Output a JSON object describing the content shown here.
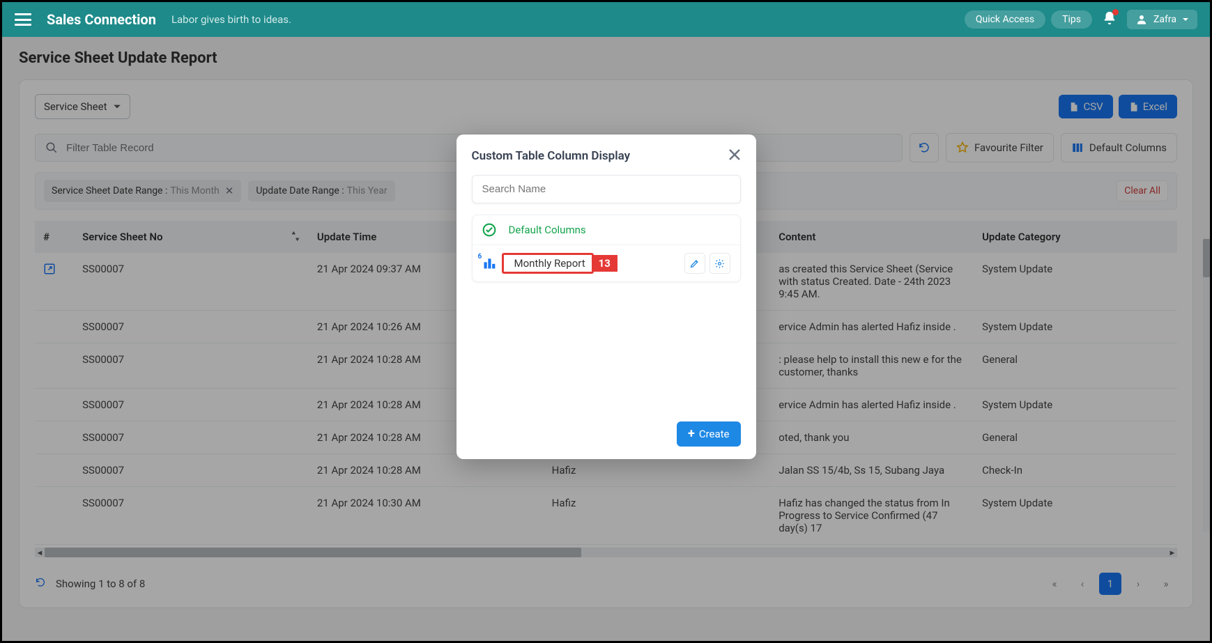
{
  "topbar": {
    "brand": "Sales Connection",
    "tagline": "Labor gives birth to ideas.",
    "quick_access": "Quick Access",
    "tips": "Tips",
    "user": "Zafra"
  },
  "page_title": "Service Sheet Update Report",
  "selector": {
    "label": "Service Sheet"
  },
  "export": {
    "csv": "CSV",
    "excel": "Excel"
  },
  "filter": {
    "placeholder": "Filter Table Record",
    "favourite": "Favourite Filter",
    "default_columns": "Default Columns",
    "clear_all": "Clear All",
    "chips": [
      {
        "label": "Service Sheet Date Range :",
        "value": "This Month"
      },
      {
        "label": "Update Date Range :",
        "value": "This Year"
      }
    ]
  },
  "columns": {
    "hash": "#",
    "ssn": "Service Sheet No",
    "time": "Update Time",
    "by": "",
    "content": "Content",
    "cat": "Update Category"
  },
  "rows": [
    {
      "ssn": "SS00007",
      "time": "21 Apr 2024 09:37 AM",
      "by": "",
      "content": "as created this Service Sheet (Service with status Created. Date - 24th 2023 9:45 AM.",
      "cat": "System Update",
      "open": true
    },
    {
      "ssn": "SS00007",
      "time": "21 Apr 2024 10:26 AM",
      "by": "",
      "content": "ervice Admin has alerted Hafiz inside .",
      "cat": "System Update"
    },
    {
      "ssn": "SS00007",
      "time": "21 Apr 2024 10:28 AM",
      "by": "",
      "content": ": please help to install this new e for the customer, thanks",
      "cat": "General"
    },
    {
      "ssn": "SS00007",
      "time": "21 Apr 2024 10:28 AM",
      "by": "",
      "content": "ervice Admin has alerted Hafiz inside .",
      "cat": "System Update"
    },
    {
      "ssn": "SS00007",
      "time": "21 Apr 2024 10:28 AM",
      "by": "",
      "content": "oted, thank you",
      "cat": "General"
    },
    {
      "ssn": "SS00007",
      "time": "21 Apr 2024 10:28 AM",
      "by": "Hafiz",
      "content": "Jalan SS 15/4b, Ss 15, Subang Jaya",
      "cat": "Check-In"
    },
    {
      "ssn": "SS00007",
      "time": "21 Apr 2024 10:30 AM",
      "by": "Hafiz",
      "content": "Hafiz has changed the status from In Progress to Service Confirmed (47 day(s) 17",
      "cat": "System Update"
    }
  ],
  "footer": {
    "info": "Showing 1 to 8 of 8",
    "page": "1"
  },
  "modal": {
    "title": "Custom Table Column Display",
    "search_placeholder": "Search Name",
    "default_label": "Default Columns",
    "monthly_label": "Monthly Report",
    "monthly_count": "6",
    "badge": "13",
    "create": "Create"
  }
}
